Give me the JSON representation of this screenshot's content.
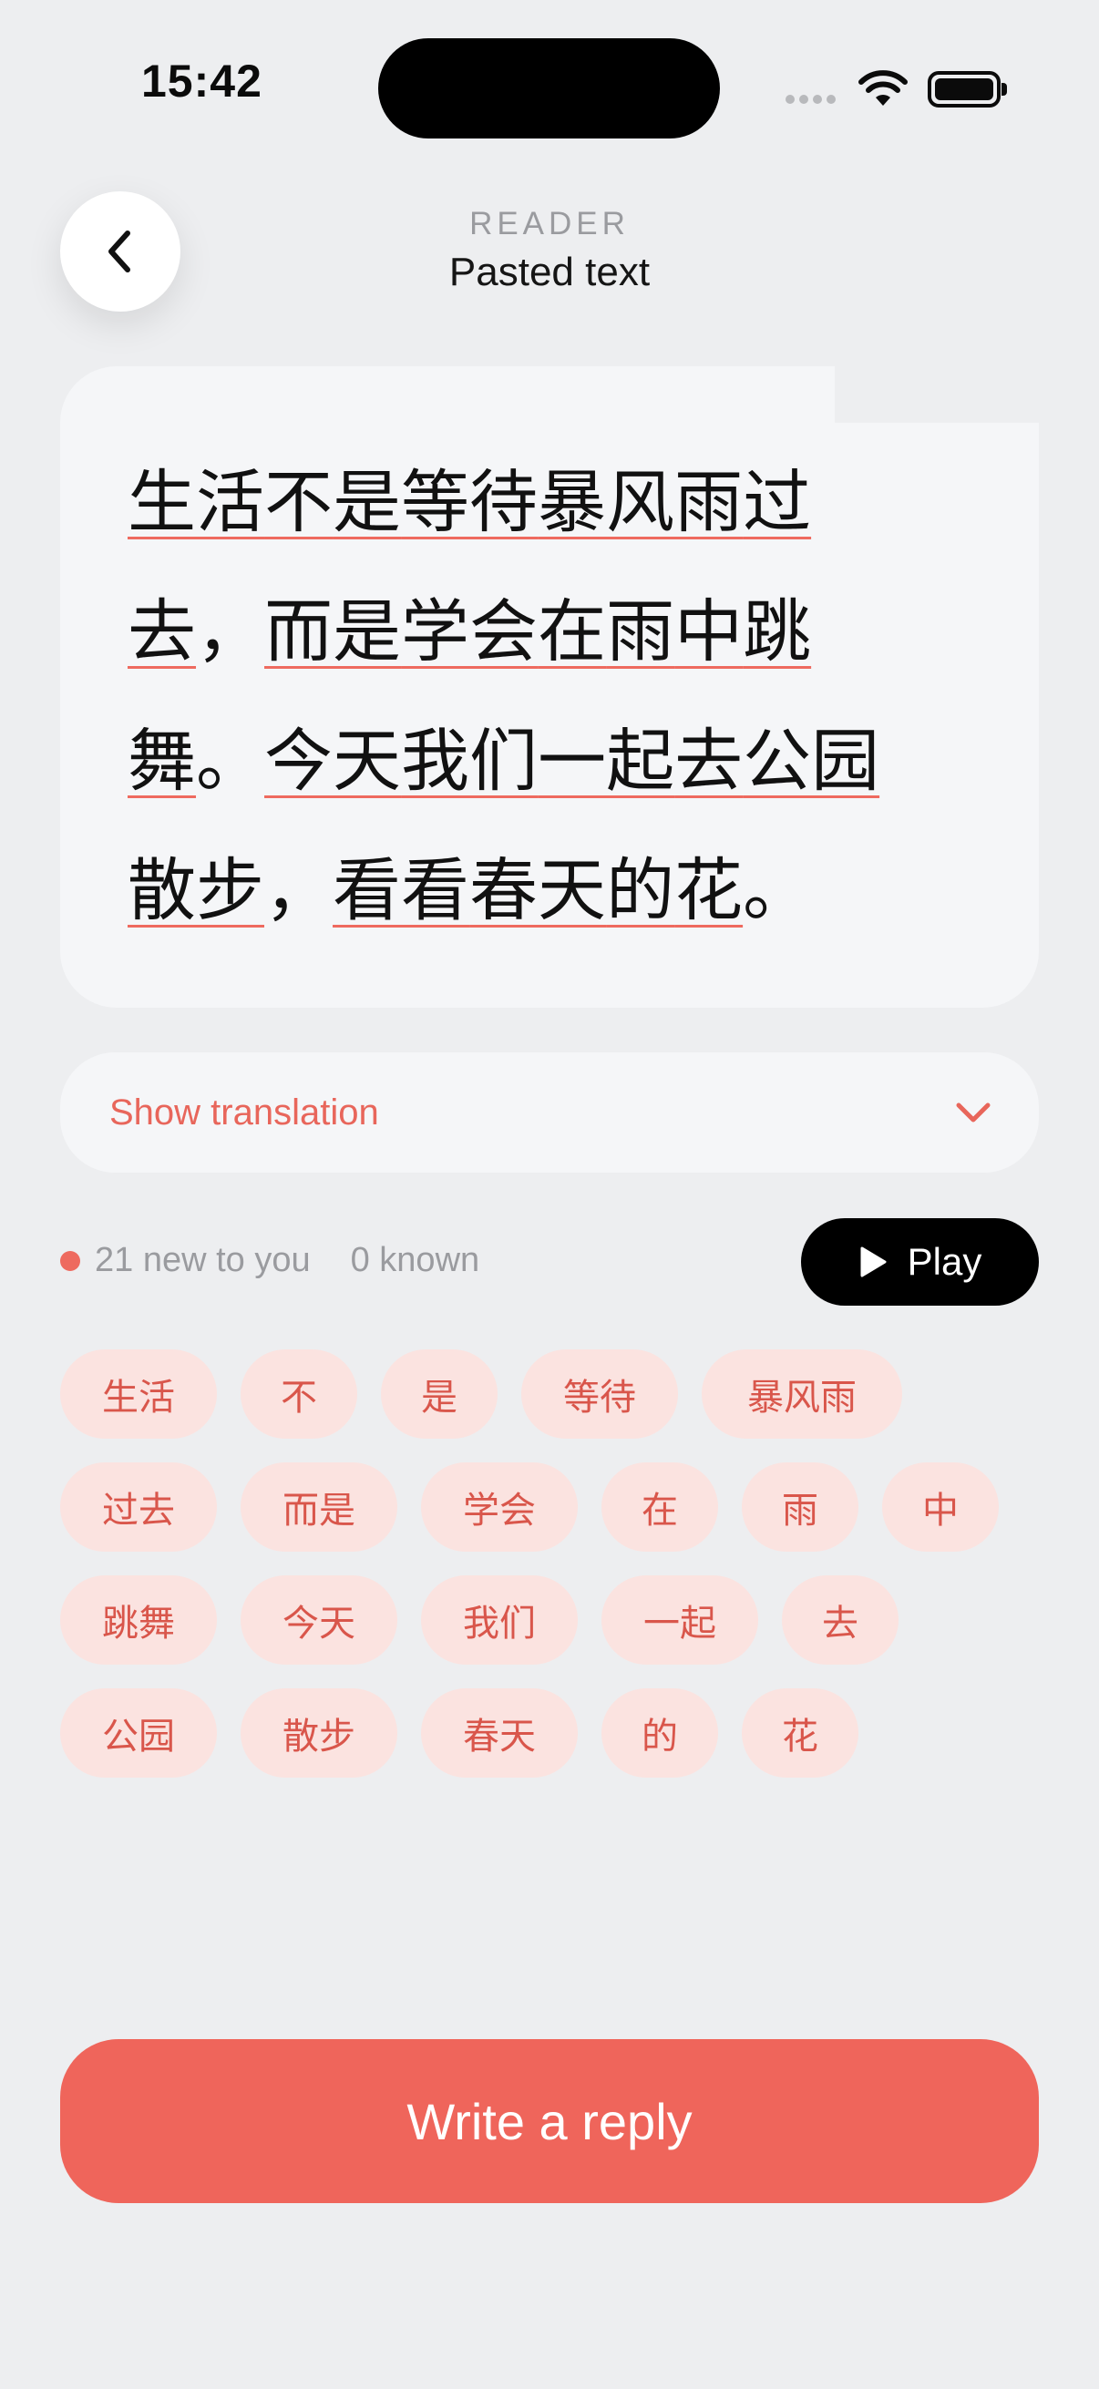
{
  "status_bar": {
    "time": "15:42"
  },
  "header": {
    "eyebrow": "READER",
    "title": "Pasted text"
  },
  "passage": {
    "segments": [
      {
        "text": "生活",
        "word": true
      },
      {
        "text": "不",
        "word": true
      },
      {
        "text": "是",
        "word": true
      },
      {
        "text": "等待",
        "word": true
      },
      {
        "text": "暴风雨",
        "word": true
      },
      {
        "text": "过去",
        "word": true
      },
      {
        "text": "，",
        "word": false
      },
      {
        "text": "而是",
        "word": true
      },
      {
        "text": "学会",
        "word": true
      },
      {
        "text": "在",
        "word": true
      },
      {
        "text": "雨",
        "word": true
      },
      {
        "text": "中",
        "word": true
      },
      {
        "text": "跳舞",
        "word": true
      },
      {
        "text": "。",
        "word": false
      },
      {
        "text": "今天",
        "word": true
      },
      {
        "text": "我们",
        "word": true
      },
      {
        "text": "一起",
        "word": true
      },
      {
        "text": "去",
        "word": true
      },
      {
        "text": "公园",
        "word": true
      },
      {
        "text": "散步",
        "word": true
      },
      {
        "text": "，",
        "word": false
      },
      {
        "text": "看看",
        "word": true
      },
      {
        "text": "春天",
        "word": true
      },
      {
        "text": "的",
        "word": true
      },
      {
        "text": "花",
        "word": true
      },
      {
        "text": "。",
        "word": false
      }
    ]
  },
  "translation": {
    "label": "Show translation"
  },
  "stats": {
    "new_label": "21 new to you",
    "known_label": "0 known"
  },
  "play": {
    "label": "Play"
  },
  "words": [
    [
      "生活",
      "不",
      "是",
      "等待",
      "暴风雨"
    ],
    [
      "过去",
      "而是",
      "学会",
      "在",
      "雨",
      "中"
    ],
    [
      "跳舞",
      "今天",
      "我们",
      "一起",
      "去"
    ],
    [
      "公园",
      "散步",
      "春天",
      "的",
      "花"
    ]
  ],
  "reply": {
    "label": "Write a reply"
  },
  "colors": {
    "accent": "#ef655b",
    "chip_bg": "#fbe3e0",
    "chip_text": "#d9564b",
    "background": "#edeef0"
  }
}
